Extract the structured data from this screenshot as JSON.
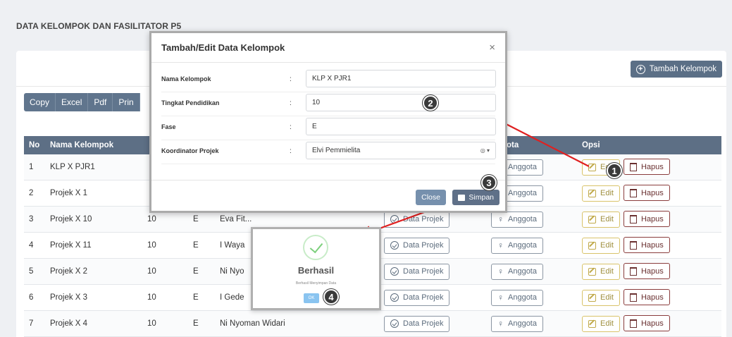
{
  "page": {
    "title": "DATA KELOMPOK DAN FASILITATOR P5"
  },
  "toolbar": {
    "add_label": "Tambah Kelompok",
    "export": [
      "Copy",
      "Excel",
      "Pdf",
      "Prin"
    ]
  },
  "table": {
    "headers": {
      "no": "No",
      "name": "Nama Kelompok",
      "anggota": "gota",
      "opsi": "Opsi"
    },
    "rows": [
      {
        "no": "1",
        "name": "KLP X PJR1",
        "tingkat": "",
        "fase": "",
        "koor": ""
      },
      {
        "no": "2",
        "name": "Projek X 1",
        "tingkat": "",
        "fase": "",
        "koor": ""
      },
      {
        "no": "3",
        "name": "Projek X 10",
        "tingkat": "10",
        "fase": "E",
        "koor": "Eva Fit..."
      },
      {
        "no": "4",
        "name": "Projek X 11",
        "tingkat": "10",
        "fase": "E",
        "koor": "I Waya"
      },
      {
        "no": "5",
        "name": "Projek X 2",
        "tingkat": "10",
        "fase": "E",
        "koor": "Ni Nyo"
      },
      {
        "no": "6",
        "name": "Projek X 3",
        "tingkat": "10",
        "fase": "E",
        "koor": "I Gede"
      },
      {
        "no": "7",
        "name": "Projek X 4",
        "tingkat": "10",
        "fase": "E",
        "koor": "Ni Nyoman Widari"
      }
    ],
    "btn_projek": "Data Projek",
    "btn_anggota": "Anggota",
    "btn_edit": "Edit",
    "btn_hapus": "Hapus"
  },
  "modal": {
    "title": "Tambah/Edit Data Kelompok",
    "close_glyph": "×",
    "colon": ":",
    "fields": {
      "nama_label": "Nama Kelompok",
      "nama_value": "KLP X PJR1",
      "tingkat_label": "Tingkat Pendidikan",
      "tingkat_value": "10",
      "fase_label": "Fase",
      "fase_value": "E",
      "koor_label": "Koordinator Projek",
      "koor_value": "Elvi Pemmielita"
    },
    "close_label": "Close",
    "simpan_label": "Simpan"
  },
  "success": {
    "title": "Berhasil",
    "message": "Berhasil Menyimpan Data",
    "ok_label": "OK"
  },
  "markers": [
    "1",
    "2",
    "3",
    "4"
  ],
  "colors": {
    "accent": "#5d6f85",
    "arrow": "#e02020",
    "success": "#7dd07d"
  }
}
